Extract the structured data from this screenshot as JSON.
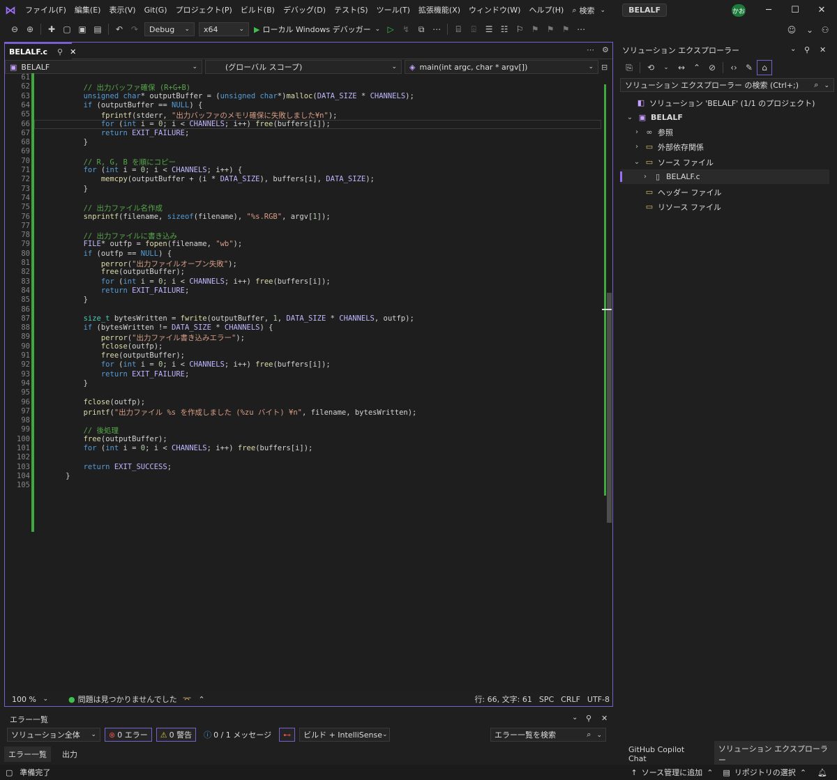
{
  "menubar": {
    "items": [
      "ファイル(F)",
      "編集(E)",
      "表示(V)",
      "Git(G)",
      "プロジェクト(P)",
      "ビルド(B)",
      "デバッグ(D)",
      "テスト(S)",
      "ツール(T)",
      "拡張機能(X)",
      "ウィンドウ(W)",
      "ヘルプ(H)"
    ],
    "search_label": "検索",
    "solution_name": "BELALF",
    "avatar": "かお"
  },
  "toolbar": {
    "config": "Debug",
    "platform": "x64",
    "run_label": "ローカル Windows デバッガー"
  },
  "editor": {
    "tab_label": "BELALF.c",
    "nav_project": "BELALF",
    "nav_scope": "(グローバル スコープ)",
    "nav_member": "main(int argc, char * argv[])",
    "zoom": "100 %",
    "issues": "問題は見つかりませんでした",
    "position": "行: 66, 文字: 61",
    "spc": "SPC",
    "eol": "CRLF",
    "encoding": "UTF-8"
  },
  "code_lines": [
    {
      "n": "61",
      "t": ""
    },
    {
      "n": "62",
      "t": "        // 出力バッファ確保 (R+G+B)"
    },
    {
      "n": "63",
      "t": "        unsigned char* outputBuffer = (unsigned char*)malloc(DATA_SIZE * CHANNELS);"
    },
    {
      "n": "64",
      "t": "        if (outputBuffer == NULL) {"
    },
    {
      "n": "65",
      "t": "            fprintf(stderr, \"出力バッファのメモリ確保に失敗しました¥n\");"
    },
    {
      "n": "66",
      "t": "            for (int i = 0; i < CHANNELS; i++) free(buffers[i]);"
    },
    {
      "n": "67",
      "t": "            return EXIT_FAILURE;"
    },
    {
      "n": "68",
      "t": "        }"
    },
    {
      "n": "69",
      "t": ""
    },
    {
      "n": "70",
      "t": "        // R, G, B を順にコピー"
    },
    {
      "n": "71",
      "t": "        for (int i = 0; i < CHANNELS; i++) {"
    },
    {
      "n": "72",
      "t": "            memcpy(outputBuffer + (i * DATA_SIZE), buffers[i], DATA_SIZE);"
    },
    {
      "n": "73",
      "t": "        }"
    },
    {
      "n": "74",
      "t": ""
    },
    {
      "n": "75",
      "t": "        // 出力ファイル名作成"
    },
    {
      "n": "76",
      "t": "        snprintf(filename, sizeof(filename), \"%s.RGB\", argv[1]);"
    },
    {
      "n": "77",
      "t": ""
    },
    {
      "n": "78",
      "t": "        // 出力ファイルに書き込み"
    },
    {
      "n": "79",
      "t": "        FILE* outfp = fopen(filename, \"wb\");"
    },
    {
      "n": "80",
      "t": "        if (outfp == NULL) {"
    },
    {
      "n": "81",
      "t": "            perror(\"出力ファイルオープン失敗\");"
    },
    {
      "n": "82",
      "t": "            free(outputBuffer);"
    },
    {
      "n": "83",
      "t": "            for (int i = 0; i < CHANNELS; i++) free(buffers[i]);"
    },
    {
      "n": "84",
      "t": "            return EXIT_FAILURE;"
    },
    {
      "n": "85",
      "t": "        }"
    },
    {
      "n": "86",
      "t": ""
    },
    {
      "n": "87",
      "t": "        size_t bytesWritten = fwrite(outputBuffer, 1, DATA_SIZE * CHANNELS, outfp);"
    },
    {
      "n": "88",
      "t": "        if (bytesWritten != DATA_SIZE * CHANNELS) {"
    },
    {
      "n": "89",
      "t": "            perror(\"出力ファイル書き込みエラー\");"
    },
    {
      "n": "90",
      "t": "            fclose(outfp);"
    },
    {
      "n": "91",
      "t": "            free(outputBuffer);"
    },
    {
      "n": "92",
      "t": "            for (int i = 0; i < CHANNELS; i++) free(buffers[i]);"
    },
    {
      "n": "93",
      "t": "            return EXIT_FAILURE;"
    },
    {
      "n": "94",
      "t": "        }"
    },
    {
      "n": "95",
      "t": ""
    },
    {
      "n": "96",
      "t": "        fclose(outfp);"
    },
    {
      "n": "97",
      "t": "        printf(\"出力ファイル %s を作成しました (%zu バイト) ¥n\", filename, bytesWritten);"
    },
    {
      "n": "98",
      "t": ""
    },
    {
      "n": "99",
      "t": "        // 後処理"
    },
    {
      "n": "100",
      "t": "        free(outputBuffer);"
    },
    {
      "n": "101",
      "t": "        for (int i = 0; i < CHANNELS; i++) free(buffers[i]);"
    },
    {
      "n": "102",
      "t": ""
    },
    {
      "n": "103",
      "t": "        return EXIT_SUCCESS;"
    },
    {
      "n": "104",
      "t": "    }"
    },
    {
      "n": "105",
      "t": ""
    }
  ],
  "solution_explorer": {
    "title": "ソリューション エクスプローラー",
    "search_placeholder": "ソリューション エクスプローラー の検索 (Ctrl+;)",
    "tree": [
      {
        "label": "ソリューション 'BELALF' (1/1 のプロジェクト)",
        "icon": "solution-icon"
      },
      {
        "label": "BELALF",
        "icon": "project-icon"
      },
      {
        "label": "参照",
        "icon": "references-icon"
      },
      {
        "label": "外部依存関係",
        "icon": "external-deps-icon"
      },
      {
        "label": "ソース ファイル",
        "icon": "folder-icon"
      },
      {
        "label": "BELALF.c",
        "icon": "c-file-icon"
      },
      {
        "label": "ヘッダー ファイル",
        "icon": "folder-icon"
      },
      {
        "label": "リソース ファイル",
        "icon": "folder-icon"
      }
    ],
    "tabs": [
      "GitHub Copilot Chat",
      "ソリューション エクスプローラー"
    ]
  },
  "error_list": {
    "title": "エラー一覧",
    "scope": "ソリューション全体",
    "errors": "0 エラー",
    "warnings": "0 警告",
    "messages": "0 / 1 メッセージ",
    "source": "ビルド + IntelliSense",
    "search_placeholder": "エラー一覧を検索",
    "tabs": [
      "エラー一覧",
      "出力"
    ]
  },
  "statusbar": {
    "ready": "準備完了",
    "scm": "ソース管理に追加",
    "repo": "リポジトリの選択"
  }
}
